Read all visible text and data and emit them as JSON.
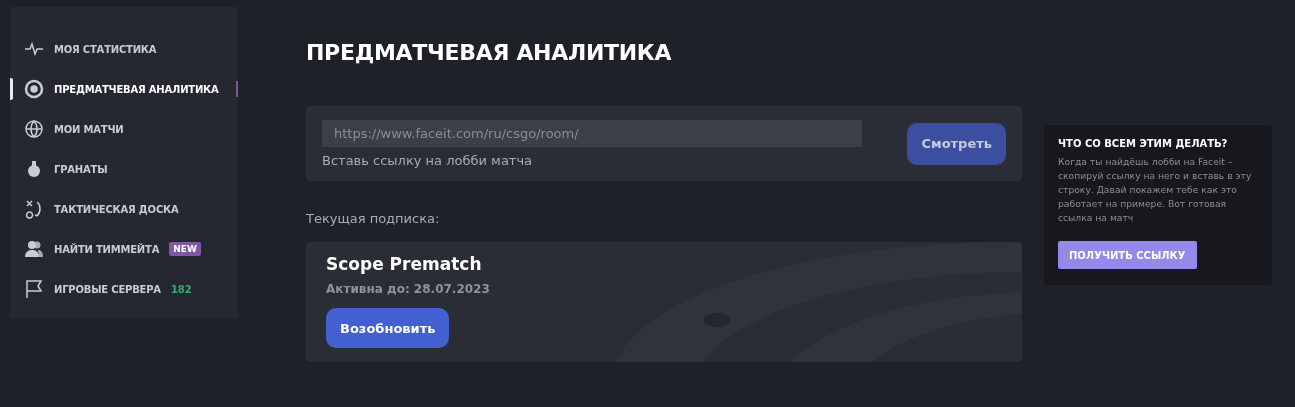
{
  "sidebar": {
    "items": [
      {
        "label": "МОЯ СТАТИСТИКА",
        "selected": false
      },
      {
        "label": "ПРЕДМАТЧЕВАЯ АНАЛИТИКА",
        "selected": true
      },
      {
        "label": "МОИ МАТЧИ",
        "selected": false
      },
      {
        "label": "ГРАНАТЫ",
        "selected": false
      },
      {
        "label": "ТАКТИЧЕСКАЯ ДОСКА",
        "selected": false
      },
      {
        "label": "НАЙТИ ТИММЕЙТА",
        "selected": false,
        "badge": {
          "kind": "tag",
          "text": "NEW",
          "color": "#7e57a5"
        }
      },
      {
        "label": "ИГРОВЫЕ СЕРВЕРА",
        "selected": false,
        "badge": {
          "kind": "count",
          "text": "182",
          "color": "#3ea66b"
        }
      }
    ]
  },
  "page_title": "ПРЕДМАТЧЕВАЯ АНАЛИТИКА",
  "lobby": {
    "placeholder": "https://www.faceit.com/ru/csgo/room/",
    "hint": "Вставь ссылку на лобби матча",
    "button": "Смотреть"
  },
  "subscription_label": "Текущая подписка:",
  "subscription": {
    "name": "Scope Prematch",
    "active_until": "Активна до: 28.07.2023",
    "button": "Возобновить"
  },
  "help": {
    "title": "ЧТО СО ВСЕМ ЭТИМ ДЕЛАТЬ?",
    "text": "Когда ты найдёшь лобби на Faceit – скопируй ссылку на него и вставь в эту строку. Давай покажем тебе как это работает на примере. Вот готовая ссылка на матч",
    "button": "ПОЛУЧИТЬ ССЫЛКУ"
  }
}
